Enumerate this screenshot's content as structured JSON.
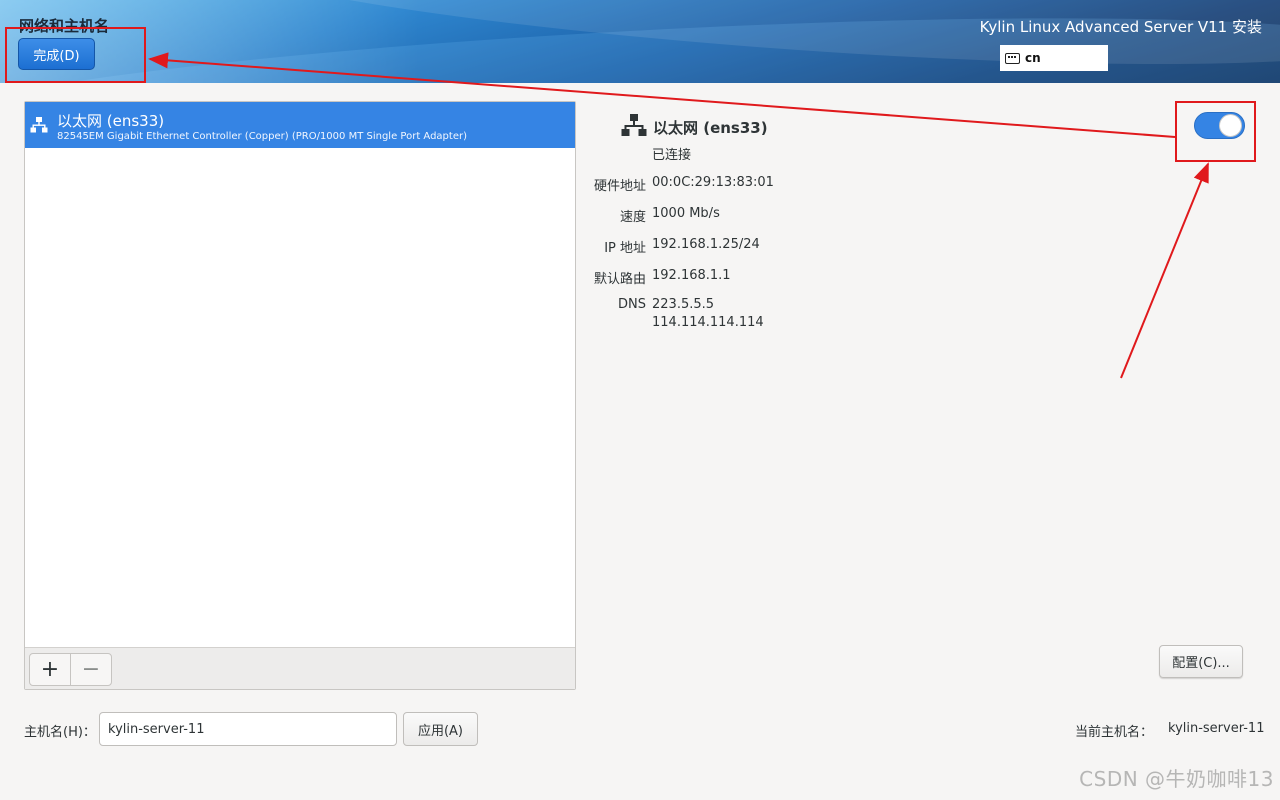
{
  "header": {
    "page_title": "网络和主机名",
    "done_label": "完成(D)",
    "installer_title": "Kylin Linux Advanced Server V11 安装",
    "keyboard_layout": "cn"
  },
  "devices": {
    "items": [
      {
        "name": "以太网 (ens33)",
        "description": "82545EM Gigabit Ethernet Controller (Copper) (PRO/1000 MT Single Port Adapter)",
        "selected": true
      }
    ],
    "add_label": "+",
    "remove_label": "−"
  },
  "details": {
    "name": "以太网 (ens33)",
    "status": "已连接",
    "enabled": true,
    "rows": [
      {
        "label": "硬件地址",
        "value": "00:0C:29:13:83:01"
      },
      {
        "label": "速度",
        "value": "1000 Mb/s"
      },
      {
        "label": "IP 地址",
        "value": "192.168.1.25/24"
      },
      {
        "label": "默认路由",
        "value": "192.168.1.1"
      },
      {
        "label": "DNS",
        "value": "223.5.5.5",
        "value2": "114.114.114.114"
      }
    ],
    "configure_label": "配置(C)..."
  },
  "hostname": {
    "label": "主机名(H)：",
    "value": "kylin-server-11",
    "apply_label": "应用(A)",
    "current_label": "当前主机名：",
    "current_value": "kylin-server-11"
  },
  "watermark": "CSDN @牛奶咖啡13",
  "colors": {
    "accent": "#3584e4",
    "annotation": "#e0191c"
  }
}
